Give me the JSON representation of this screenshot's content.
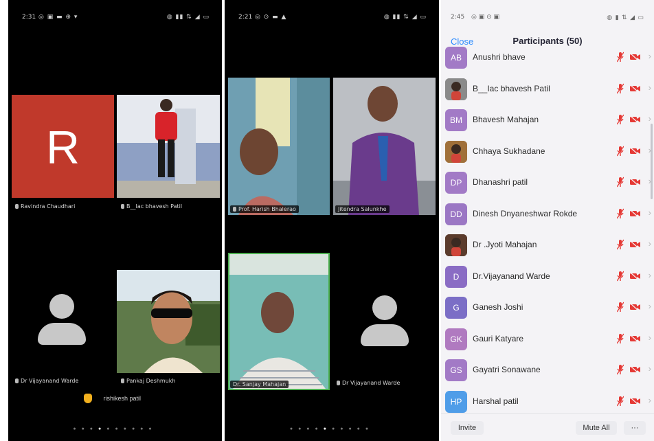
{
  "screen1": {
    "status": {
      "time": "2:31",
      "icons": "◎ ▣ ▬ ⊕ ▾",
      "right": "◍ ▮▮ ⇅ ◢ ▭"
    },
    "tiles": [
      {
        "initial": "R",
        "label": "Ravindra Chaudhari"
      },
      {
        "label": "B__Iac bhavesh Patil"
      },
      {
        "label": "Dr Vijayanand Warde"
      },
      {
        "label": "Pankaj Deshmukh"
      }
    ],
    "raised_hand": {
      "name": "rishikesh patil",
      "icon": "raised-hand-icon"
    },
    "page_dots": 10,
    "active_dot": 4
  },
  "screen2": {
    "status": {
      "time": "2:21",
      "icons": "◎ ⊙ ▬ ▲",
      "right": "◍ ▮▮ ⇅ ◢ ▭"
    },
    "tiles": [
      {
        "label": "Prof. Harish Bhalerao"
      },
      {
        "label": "Jitendra Salunkhe"
      },
      {
        "label": "Dr. Sanjay Mahajan"
      },
      {
        "label": "Dr Vijayanand Warde"
      }
    ],
    "page_dots": 10,
    "active_dot": 4
  },
  "screen3": {
    "status": {
      "time": "2:45",
      "icons": "◎ ▣ ⊙ ▣",
      "right": "◍ ▮ ⇅ ◢ ▭"
    },
    "close_label": "Close",
    "title": "Participants (50)",
    "participants": [
      {
        "initials": "AB",
        "name": "Anushri bhave",
        "color": "#a27ac6",
        "photo": false
      },
      {
        "initials": "",
        "name": "B__Iac bhavesh Patil",
        "color": "#8a8a8a",
        "photo": true
      },
      {
        "initials": "BM",
        "name": "Bhavesh Mahajan",
        "color": "#a27ac6",
        "photo": false
      },
      {
        "initials": "",
        "name": "Chhaya Sukhadane",
        "color": "#a0703a",
        "photo": true
      },
      {
        "initials": "DP",
        "name": "Dhanashri patil",
        "color": "#a27ac6",
        "photo": false
      },
      {
        "initials": "DD",
        "name": "Dinesh Dnyaneshwar Rokde",
        "color": "#9b77c4",
        "photo": false
      },
      {
        "initials": "",
        "name": "Dr .Jyoti Mahajan",
        "color": "#5b3b2c",
        "photo": true
      },
      {
        "initials": "D",
        "name": "Dr.Vijayanand  Warde",
        "color": "#8a6cc4",
        "photo": false
      },
      {
        "initials": "G",
        "name": "Ganesh  Joshi",
        "color": "#7b6ec6",
        "photo": false
      },
      {
        "initials": "GK",
        "name": "Gauri Katyare",
        "color": "#b07ac0",
        "photo": false
      },
      {
        "initials": "GS",
        "name": "Gayatri Sonawane",
        "color": "#a27ac6",
        "photo": false
      },
      {
        "initials": "HP",
        "name": "Harshal patil",
        "color": "#4f9de8",
        "photo": false
      }
    ],
    "invite_label": "Invite",
    "mute_all_label": "Mute All",
    "more_label": "···",
    "mic_color": "#e53935",
    "cam_color": "#e53935"
  }
}
